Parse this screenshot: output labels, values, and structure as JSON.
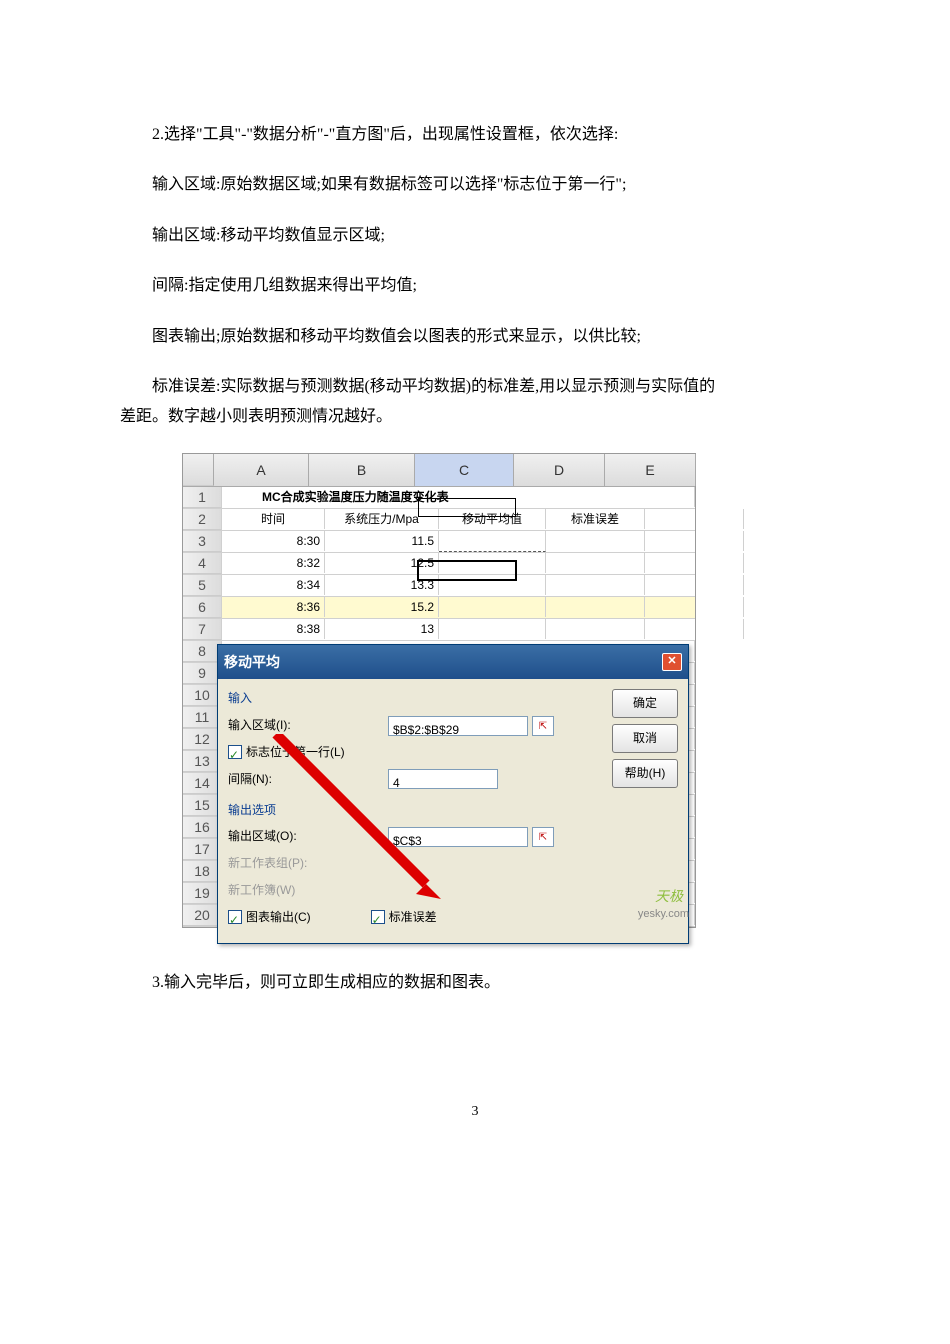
{
  "paragraphs": {
    "p1": "2.选择\"工具\"-\"数据分析\"-\"直方图\"后，出现属性设置框，依次选择:",
    "p2": "输入区域:原始数据区域;如果有数据标签可以选择\"标志位于第一行\";",
    "p3": "输出区域:移动平均数值显示区域;",
    "p4": "间隔:指定使用几组数据来得出平均值;",
    "p5": "图表输出;原始数据和移动平均数值会以图表的形式来显示，以供比较;",
    "p6a": "标准误差:实际数据与预测数据(移动平均数据)的标准差,用以显示预测与实际值的",
    "p6b": "差距。数字越小则表明预测情况越好。",
    "p7": "3.输入完毕后，则可立即生成相应的数据和图表。"
  },
  "sheet": {
    "cols": [
      "A",
      "B",
      "C",
      "D",
      "E"
    ],
    "title": "MC合成实验温度压力随温度变化表",
    "headers": {
      "A": "时间",
      "B": "系统压力/Mpa",
      "C": "移动平均值",
      "D": "标准误差",
      "E": ""
    },
    "rows": [
      {
        "n": "3",
        "A": "8:30",
        "B": "11.5"
      },
      {
        "n": "4",
        "A": "8:32",
        "B": "12.5"
      },
      {
        "n": "5",
        "A": "8:34",
        "B": "13.3"
      },
      {
        "n": "6",
        "A": "8:36",
        "B": "15.2"
      },
      {
        "n": "7",
        "A": "8:38",
        "B": "13"
      }
    ],
    "blankRows": [
      "8",
      "9",
      "10",
      "11",
      "12",
      "13",
      "14",
      "15",
      "16",
      "17",
      "18",
      "19",
      "20"
    ]
  },
  "dialog": {
    "title": "移动平均",
    "group_input": "输入",
    "input_range_label": "输入区域(I):",
    "input_range_value": "$B$2:$B$29",
    "first_row_label": "标志位于第一行(L)",
    "interval_label": "间隔(N):",
    "interval_value": "4",
    "group_output": "输出选项",
    "output_range_label": "输出区域(O):",
    "output_range_value": "$C$3",
    "new_sheet_label": "新工作表组(P):",
    "new_book_label": "新工作簿(W)",
    "chart_out_label": "图表输出(C)",
    "stderr_label": "标准误差",
    "btn_ok": "确定",
    "btn_cancel": "取消",
    "btn_help": "帮助(H)"
  },
  "watermark": "yesky.com",
  "logo_text": "天极",
  "page_number": "3"
}
